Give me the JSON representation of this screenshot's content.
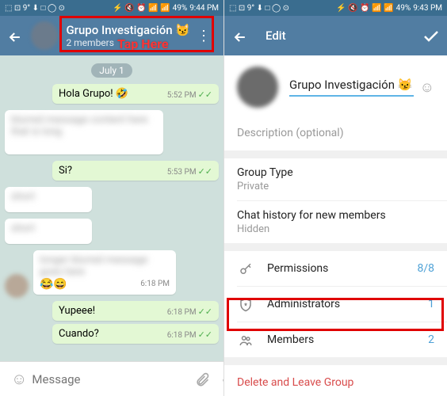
{
  "status": {
    "left": "⬚ ⊡ 9° ⬇ □ ◯ ⊙",
    "icons": "⚡ 🔇 ⏰ 📶 📶",
    "battery_left": "49%",
    "time_left": "9:44 PM",
    "battery_right": "49%",
    "time_right": "9:43 PM"
  },
  "chat": {
    "title": "Grupo Investigación 😼",
    "subtitle": "2 members",
    "tap_here": "Tap Here",
    "date": "July 1",
    "messages": [
      {
        "dir": "out",
        "text": "Hola Grupo! 🤣",
        "time": "5:52 PM",
        "checks": true
      },
      {
        "dir": "in",
        "text": "blurred message content here that is long",
        "time": "",
        "blur": true
      },
      {
        "dir": "out",
        "text": "Si?",
        "time": "5:53 PM",
        "checks": true
      },
      {
        "dir": "in",
        "text": "short",
        "time": "",
        "blur": true
      },
      {
        "dir": "in",
        "text": "short",
        "time": "",
        "blur": true
      },
      {
        "dir": "in",
        "text": "longer blurred message goes here",
        "time": "6:18 PM",
        "blur": true,
        "emoji": "😂😄"
      },
      {
        "dir": "out",
        "text": "Yupeee!",
        "time": "6:18 PM",
        "checks": true
      },
      {
        "dir": "out",
        "text": "Cuando?",
        "time": "6:18 PM",
        "checks": true
      }
    ],
    "input_placeholder": "Message"
  },
  "edit": {
    "title": "Edit",
    "name": "Grupo Investigación 😼",
    "description_placeholder": "Description (optional)",
    "group_type_label": "Group Type",
    "group_type_value": "Private",
    "history_label": "Chat history for new members",
    "history_value": "Hidden",
    "permissions_label": "Permissions",
    "permissions_value": "8/8",
    "admins_label": "Administrators",
    "admins_value": "1",
    "members_label": "Members",
    "members_value": "2",
    "delete_label": "Delete and Leave Group"
  }
}
